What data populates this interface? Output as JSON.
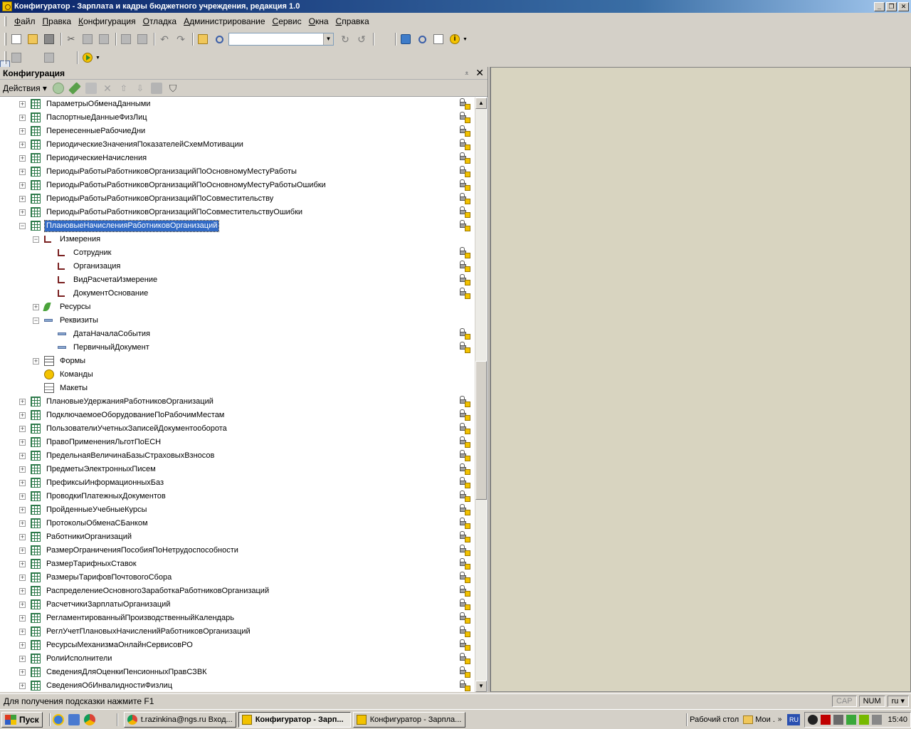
{
  "window": {
    "title": "Конфигуратор - Зарплата и кадры бюджетного учреждения, редакция 1.0",
    "minimize": "_",
    "restore": "❐",
    "close": "✕"
  },
  "menu": [
    "Файл",
    "Правка",
    "Конфигурация",
    "Отладка",
    "Администрирование",
    "Сервис",
    "Окна",
    "Справка"
  ],
  "toolbar": {
    "search_value": ""
  },
  "panel": {
    "title": "Конфигурация",
    "pin": "ᴥ",
    "close": "✕",
    "actions_label": "Действия ▾"
  },
  "tree": [
    {
      "level": 0,
      "expander": "+",
      "icon": "register",
      "label": "ПараметрыОбменаДанными",
      "lock": true
    },
    {
      "level": 0,
      "expander": "+",
      "icon": "register",
      "label": "ПаспортныеДанныеФизЛиц",
      "lock": true
    },
    {
      "level": 0,
      "expander": "+",
      "icon": "register",
      "label": "ПеренесенныеРабочиеДни",
      "lock": true
    },
    {
      "level": 0,
      "expander": "+",
      "icon": "register",
      "label": "ПериодическиеЗначенияПоказателейСхемМотивации",
      "lock": true
    },
    {
      "level": 0,
      "expander": "+",
      "icon": "register",
      "label": "ПериодическиеНачисления",
      "lock": true
    },
    {
      "level": 0,
      "expander": "+",
      "icon": "register",
      "label": "ПериодыРаботыРаботниковОрганизацийПоОсновномуМестуРаботы",
      "lock": true
    },
    {
      "level": 0,
      "expander": "+",
      "icon": "register",
      "label": "ПериодыРаботыРаботниковОрганизацийПоОсновномуМестуРаботыОшибки",
      "lock": true
    },
    {
      "level": 0,
      "expander": "+",
      "icon": "register",
      "label": "ПериодыРаботыРаботниковОрганизацийПоСовместительству",
      "lock": true
    },
    {
      "level": 0,
      "expander": "+",
      "icon": "register",
      "label": "ПериодыРаботыРаботниковОрганизацийПоСовместительствуОшибки",
      "lock": true
    },
    {
      "level": 0,
      "expander": "−",
      "icon": "register",
      "label": "ПлановыеНачисленияРаботниковОрганизаций",
      "lock": true,
      "selected": true
    },
    {
      "level": 1,
      "expander": "−",
      "icon": "dimension",
      "label": "Измерения",
      "lock": false
    },
    {
      "level": 2,
      "expander": "",
      "icon": "dimension",
      "label": "Сотрудник",
      "lock": true
    },
    {
      "level": 2,
      "expander": "",
      "icon": "dimension",
      "label": "Организация",
      "lock": true
    },
    {
      "level": 2,
      "expander": "",
      "icon": "dimension",
      "label": "ВидРасчетаИзмерение",
      "lock": true
    },
    {
      "level": 2,
      "expander": "",
      "icon": "dimension",
      "label": "ДокументОснование",
      "lock": true
    },
    {
      "level": 1,
      "expander": "+",
      "icon": "resource",
      "label": "Ресурсы",
      "lock": false
    },
    {
      "level": 1,
      "expander": "−",
      "icon": "attribute",
      "label": "Реквизиты",
      "lock": false
    },
    {
      "level": 2,
      "expander": "",
      "icon": "attribute",
      "label": "ДатаНачалаСобытия",
      "lock": true
    },
    {
      "level": 2,
      "expander": "",
      "icon": "attribute",
      "label": "ПервичныйДокумент",
      "lock": true
    },
    {
      "level": 1,
      "expander": "+",
      "icon": "forms",
      "label": "Формы",
      "lock": false
    },
    {
      "level": 1,
      "expander": "",
      "icon": "commands",
      "label": "Команды",
      "lock": false
    },
    {
      "level": 1,
      "expander": "",
      "icon": "layouts",
      "label": "Макеты",
      "lock": false
    },
    {
      "level": 0,
      "expander": "+",
      "icon": "register",
      "label": "ПлановыеУдержанияРаботниковОрганизаций",
      "lock": true
    },
    {
      "level": 0,
      "expander": "+",
      "icon": "register",
      "label": "ПодключаемоеОборудованиеПоРабочимМестам",
      "lock": true
    },
    {
      "level": 0,
      "expander": "+",
      "icon": "register",
      "label": "ПользователиУчетныхЗаписейДокументооборота",
      "lock": true
    },
    {
      "level": 0,
      "expander": "+",
      "icon": "register",
      "label": "ПравоПримененияЛьготПоЕСН",
      "lock": true
    },
    {
      "level": 0,
      "expander": "+",
      "icon": "register",
      "label": "ПредельнаяВеличинаБазыСтраховыхВзносов",
      "lock": true
    },
    {
      "level": 0,
      "expander": "+",
      "icon": "register",
      "label": "ПредметыЭлектронныхПисем",
      "lock": true
    },
    {
      "level": 0,
      "expander": "+",
      "icon": "register",
      "label": "ПрефиксыИнформационныхБаз",
      "lock": true
    },
    {
      "level": 0,
      "expander": "+",
      "icon": "register",
      "label": "ПроводкиПлатежныхДокументов",
      "lock": true
    },
    {
      "level": 0,
      "expander": "+",
      "icon": "register",
      "label": "ПройденныеУчебныеКурсы",
      "lock": true
    },
    {
      "level": 0,
      "expander": "+",
      "icon": "register",
      "label": "ПротоколыОбменаСБанком",
      "lock": true
    },
    {
      "level": 0,
      "expander": "+",
      "icon": "register",
      "label": "РаботникиОрганизаций",
      "lock": true
    },
    {
      "level": 0,
      "expander": "+",
      "icon": "register",
      "label": "РазмерОграниченияПособияПоНетрудоспособности",
      "lock": true
    },
    {
      "level": 0,
      "expander": "+",
      "icon": "register",
      "label": "РазмерТарифныхСтавок",
      "lock": true
    },
    {
      "level": 0,
      "expander": "+",
      "icon": "register",
      "label": "РазмерыТарифовПочтовогоСбора",
      "lock": true
    },
    {
      "level": 0,
      "expander": "+",
      "icon": "register",
      "label": "РаспределениеОсновногоЗаработкаРаботниковОрганизаций",
      "lock": true
    },
    {
      "level": 0,
      "expander": "+",
      "icon": "register",
      "label": "РасчетчикиЗарплатыОрганизаций",
      "lock": true
    },
    {
      "level": 0,
      "expander": "+",
      "icon": "register",
      "label": "РегламентированныйПроизводственныйКалендарь",
      "lock": true
    },
    {
      "level": 0,
      "expander": "+",
      "icon": "register",
      "label": "РеглУчетПлановыхНачисленийРаботниковОрганизаций",
      "lock": true
    },
    {
      "level": 0,
      "expander": "+",
      "icon": "register",
      "label": "РесурсыМеханизмаОнлайнСервисовРО",
      "lock": true
    },
    {
      "level": 0,
      "expander": "+",
      "icon": "register",
      "label": "РолиИсполнители",
      "lock": true
    },
    {
      "level": 0,
      "expander": "+",
      "icon": "register",
      "label": "СведенияДляОценкиПенсионныхПравСЗВК",
      "lock": true
    },
    {
      "level": 0,
      "expander": "+",
      "icon": "register",
      "label": "СведенияОбИнвалидностиФизлиц",
      "lock": true
    }
  ],
  "scrollbar": {
    "up": "▲",
    "down": "▼"
  },
  "status": {
    "hint": "Для получения подсказки нажмите F1",
    "cap": "CAP",
    "num": "NUM",
    "lang": "ru ▾"
  },
  "taskbar": {
    "start_label": "Пуск",
    "tasks": [
      {
        "icon": "chrome",
        "label": "t.razinkina@ngs.ru Вход...",
        "active": false
      },
      {
        "icon": "onec",
        "label": "Конфигуратор - Зарп...",
        "active": true
      },
      {
        "icon": "onec",
        "label": "Конфигуратор - Зарпла...",
        "active": false
      }
    ],
    "desktop_label": "Рабочий стол",
    "my_label": "Мои .",
    "chevron": "»",
    "lang": "RU",
    "clock": "15:40"
  }
}
